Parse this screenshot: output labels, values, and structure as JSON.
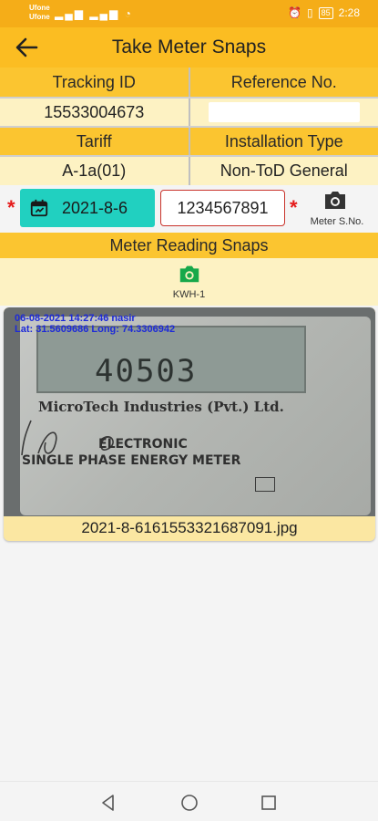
{
  "status_bar": {
    "carrier_1": "Ufone",
    "carrier_2": "Ufone",
    "battery": "85",
    "time": "2:28"
  },
  "app_bar": {
    "title": "Take Meter Snaps",
    "back_icon": "arrow-back-icon"
  },
  "details": {
    "tracking_id_label": "Tracking ID",
    "reference_no_label": "Reference No.",
    "tracking_id": "15533004673",
    "reference_no": "",
    "tariff_label": "Tariff",
    "installation_type_label": "Installation Type",
    "tariff": "A-1a(01)",
    "installation_type": "Non-ToD General"
  },
  "meter_row": {
    "date": "2021-8-6",
    "meter_serial": "1234567891",
    "camera_label": "Meter S.No."
  },
  "snaps": {
    "section_title": "Meter Reading Snaps",
    "kwh_label": "KWH-1"
  },
  "photo": {
    "overlay_line_1": "06-08-2021 14:27:46 nasir",
    "overlay_line_2": "Lat: 31.5609686 Long: 74.3306942",
    "manufacturer": "MicroTech Industries (Pvt.) Ltd.",
    "meter_type_1": "ELECTRONIC",
    "meter_type_2": "SINGLE PHASE ENERGY METER",
    "display_reading": "40503",
    "filename": "2021-8-6161553321687091.jpg"
  },
  "colors": {
    "status_bar": "#f5ad18",
    "app_bar": "#fbbd22",
    "header_cell": "#fbc530",
    "value_cell": "#fdf2c3",
    "date_button": "#21d0c0",
    "required_star": "#e51b1b",
    "camera_green": "#17a84a"
  }
}
